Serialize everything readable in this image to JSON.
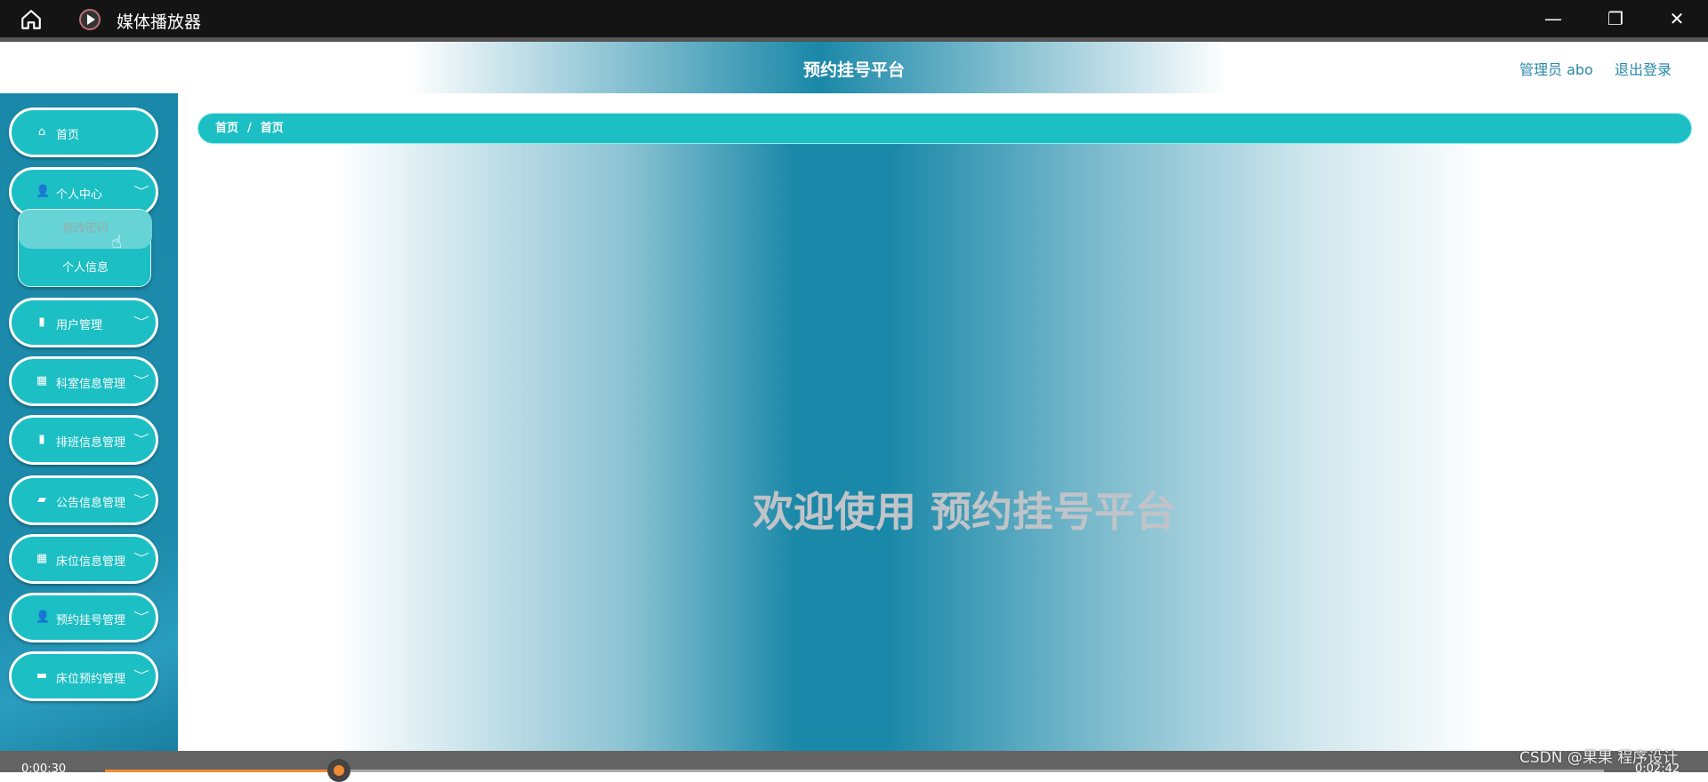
{
  "window": {
    "title": "媒体播放器",
    "minimize": "—",
    "restore": "❐",
    "close": "✕"
  },
  "header": {
    "title": "预约挂号平台",
    "user": "管理员 abo",
    "logout": "退出登录"
  },
  "sidebar": {
    "items": [
      {
        "label": "首页",
        "icon": "⌂",
        "has_chevron": false
      },
      {
        "label": "个人中心",
        "icon": "👤",
        "has_chevron": true
      },
      {
        "label": "用户管理",
        "icon": "▮",
        "has_chevron": true
      },
      {
        "label": "科室信息管理",
        "icon": "▦",
        "has_chevron": true
      },
      {
        "label": "排班信息管理",
        "icon": "▮",
        "has_chevron": true
      },
      {
        "label": "公告信息管理",
        "icon": "▰",
        "has_chevron": true
      },
      {
        "label": "床位信息管理",
        "icon": "▦",
        "has_chevron": true
      },
      {
        "label": "预约挂号管理",
        "icon": "👤",
        "has_chevron": true
      },
      {
        "label": "床位预约管理",
        "icon": "▬",
        "has_chevron": true
      }
    ],
    "submenu": [
      {
        "label": "修改密码",
        "hovered": true
      },
      {
        "label": "个人信息"
      }
    ],
    "chevron": "﹀"
  },
  "breadcrumb": [
    "首页",
    "/",
    "首页"
  ],
  "welcome": "欢迎使用 预约挂号平台",
  "player": {
    "current": "0:00:30",
    "total": "0:02:42",
    "progress": 0.156
  },
  "watermark": "CSDN @果果 程序设计",
  "colors": {
    "accent": "#1bbfc4",
    "sidebar": "#1a88a8",
    "progress": "#f28a30"
  }
}
